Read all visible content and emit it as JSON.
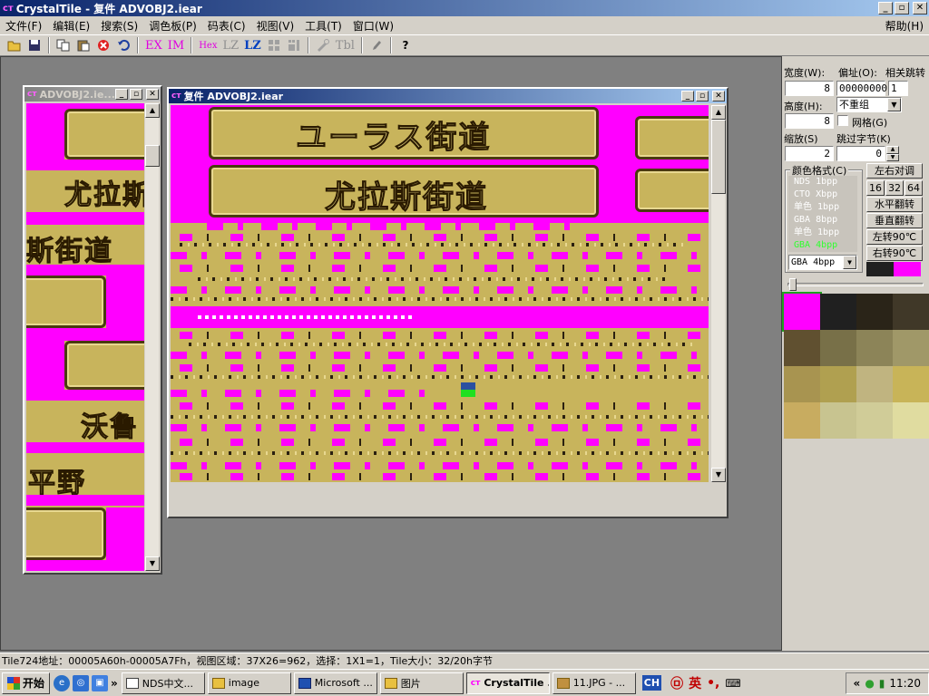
{
  "app": {
    "title": "CrystalTile - 复件 ADVOBJ2.iear",
    "icon": "crystaltile-app-icon",
    "caption_min": "_",
    "caption_max": "▫",
    "caption_close": "✕"
  },
  "menu": {
    "items": [
      "文件(F)",
      "编辑(E)",
      "搜索(S)",
      "调色板(P)",
      "码表(C)",
      "视图(V)",
      "工具(T)",
      "窗口(W)"
    ],
    "help": "帮助(H)"
  },
  "toolbar": {
    "ex": "EX",
    "im": "IM",
    "hex": "Hex",
    "lz1": "LZ",
    "lz2": "LZ",
    "tbl": "Tbl",
    "help": "?"
  },
  "child_left": {
    "title": "ADVOBJ2.ie..."
  },
  "child_main": {
    "title": "复件 ADVOBJ2.iear"
  },
  "tiles": {
    "left_text_1": "尤拉斯",
    "left_text_2": "斯街道",
    "left_text_3": "沃鲁",
    "left_text_4": "平野",
    "main_text_1": "ユーラス街道",
    "main_text_2": "尤拉斯街道"
  },
  "panel": {
    "width_label": "宽度(W):",
    "offset_label": "偏址(O):",
    "jump_label": "相关跳转",
    "width_value": "8",
    "offset_value": "00000000",
    "jump_value": "1",
    "height_label": "高度(H):",
    "overlap_value": "不重组",
    "height_value": "8",
    "grid_label": "网格(G)",
    "zoom_label": "缩放(S)",
    "skip_label": "跳过字节(K)",
    "zoom_value": "2",
    "skip_value": "0",
    "color_format_label": "颜色格式(C)",
    "formats": [
      "NDS  1bpp",
      "CTO  Xbpp",
      "单色 1bpp",
      "GBA  8bpp",
      "单色 1bpp",
      "GBA  4bpp"
    ],
    "format_selected": "GBA  4bpp",
    "btn_lr_align": "左右对调",
    "btn_16": "16",
    "btn_32": "32",
    "btn_64": "64",
    "btn_hflip": "水平翻转",
    "btn_vflip": "垂直翻转",
    "btn_rot_left": "左转90℃",
    "btn_rot_right": "右转90℃",
    "fg_color": "#202020",
    "bg_color": "#ff00ff",
    "palette": [
      "#ff00ff",
      "#202020",
      "#2a2418",
      "#403828",
      "#605030",
      "#787048",
      "#8c8458",
      "#a09868",
      "#a89450",
      "#b0a050",
      "#c0b480",
      "#c8b458",
      "#c8ac60",
      "#c8c490",
      "#d0cc98",
      "#e0dca0"
    ]
  },
  "status": {
    "text": "Tile724地址：00005A60h-00005A7Fh，视图区域：37X26=962，选择：1X1=1，Tile大小：32/20h字节"
  },
  "taskbar": {
    "start": "开始",
    "tasks": [
      "NDS中文...",
      "image",
      "Microsoft ...",
      "图片",
      "CrystalTile ...",
      "11.JPG - ..."
    ],
    "active_task": "CrystalTile ...",
    "lang": "CH",
    "ime": "英",
    "clock": "11:20"
  }
}
